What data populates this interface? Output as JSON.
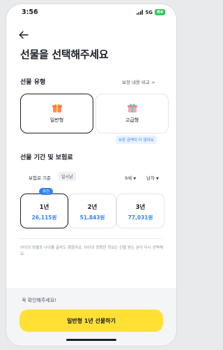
{
  "status": {
    "time": "3:56",
    "network": "5G",
    "battery": "84"
  },
  "header": {
    "title": "선물을 선택해주세요"
  },
  "gift_type": {
    "title": "선물 유형",
    "compare_link": "보장 내용 비교 >",
    "options": [
      {
        "label": "일반형",
        "selected": true
      },
      {
        "label": "고급형",
        "selected": false
      }
    ],
    "hint": "보장 금액이 더 많아요"
  },
  "period": {
    "title": "선물 기간 및 보험료",
    "basis_label": "보험료 기준",
    "basis_chip": "일시납",
    "age": "9세",
    "gender": "남자",
    "recommend_badge": "추천",
    "options": [
      {
        "years": "1년",
        "price": "26,115원",
        "selected": true
      },
      {
        "years": "2년",
        "price": "51,843원",
        "selected": false
      },
      {
        "years": "3년",
        "price": "77,031원",
        "selected": false
      }
    ]
  },
  "notice": "아이의 성별과 나이를 골라도 괜찮아요. 아이의 정확한 정보는 선물 받는 분이 다시 선택해요.",
  "footer": {
    "check_text": "꼭 확인해주세요!",
    "cta_label": "일반형 1년 선물하기"
  },
  "colors": {
    "accent_blue": "#3182f6",
    "cta_yellow": "#ffe033",
    "battery_green": "#2fc95c"
  }
}
